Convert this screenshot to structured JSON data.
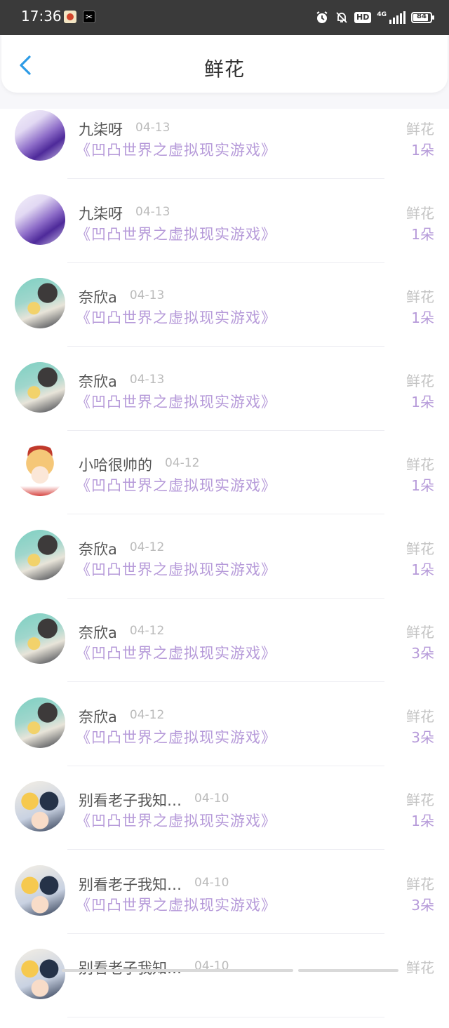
{
  "status_bar": {
    "time": "17:36",
    "app_icon_b": "✂",
    "network_badge": "HD",
    "network_type": "4G",
    "battery": "84"
  },
  "header": {
    "title": "鲜花",
    "back_icon": "chevron-left-icon"
  },
  "items": [
    {
      "name": "九柒呀",
      "date": "04-13",
      "book": "《凹凸世界之虚拟现实游戏》",
      "gift_type": "鲜花",
      "gift_count": "1朵",
      "avatar": "purple-wave"
    },
    {
      "name": "九柒呀",
      "date": "04-13",
      "book": "《凹凸世界之虚拟现实游戏》",
      "gift_type": "鲜花",
      "gift_count": "1朵",
      "avatar": "purple-wave"
    },
    {
      "name": "奈欣a",
      "date": "04-13",
      "book": "《凹凸世界之虚拟现实游戏》",
      "gift_type": "鲜花",
      "gift_count": "1朵",
      "avatar": "anime-duo"
    },
    {
      "name": "奈欣a",
      "date": "04-13",
      "book": "《凹凸世界之虚拟现实游戏》",
      "gift_type": "鲜花",
      "gift_count": "1朵",
      "avatar": "anime-duo"
    },
    {
      "name": "小哈很帅的",
      "date": "04-12",
      "book": "《凹凸世界之虚拟现实游戏》",
      "gift_type": "鲜花",
      "gift_count": "1朵",
      "avatar": "blonde-boy"
    },
    {
      "name": "奈欣a",
      "date": "04-12",
      "book": "《凹凸世界之虚拟现实游戏》",
      "gift_type": "鲜花",
      "gift_count": "1朵",
      "avatar": "anime-duo"
    },
    {
      "name": "奈欣a",
      "date": "04-12",
      "book": "《凹凸世界之虚拟现实游戏》",
      "gift_type": "鲜花",
      "gift_count": "3朵",
      "avatar": "anime-duo"
    },
    {
      "name": "奈欣a",
      "date": "04-12",
      "book": "《凹凸世界之虚拟现实游戏》",
      "gift_type": "鲜花",
      "gift_count": "3朵",
      "avatar": "anime-duo"
    },
    {
      "name": "别看老子我知…",
      "date": "04-10",
      "book": "《凹凸世界之虚拟现实游戏》",
      "gift_type": "鲜花",
      "gift_count": "1朵",
      "avatar": "anime-group"
    },
    {
      "name": "别看老子我知…",
      "date": "04-10",
      "book": "《凹凸世界之虚拟现实游戏》",
      "gift_type": "鲜花",
      "gift_count": "3朵",
      "avatar": "anime-group"
    },
    {
      "name": "别看老子我知…",
      "date": "04-10",
      "book": "",
      "gift_type": "鲜花",
      "gift_count": "",
      "avatar": "anime-group"
    }
  ]
}
